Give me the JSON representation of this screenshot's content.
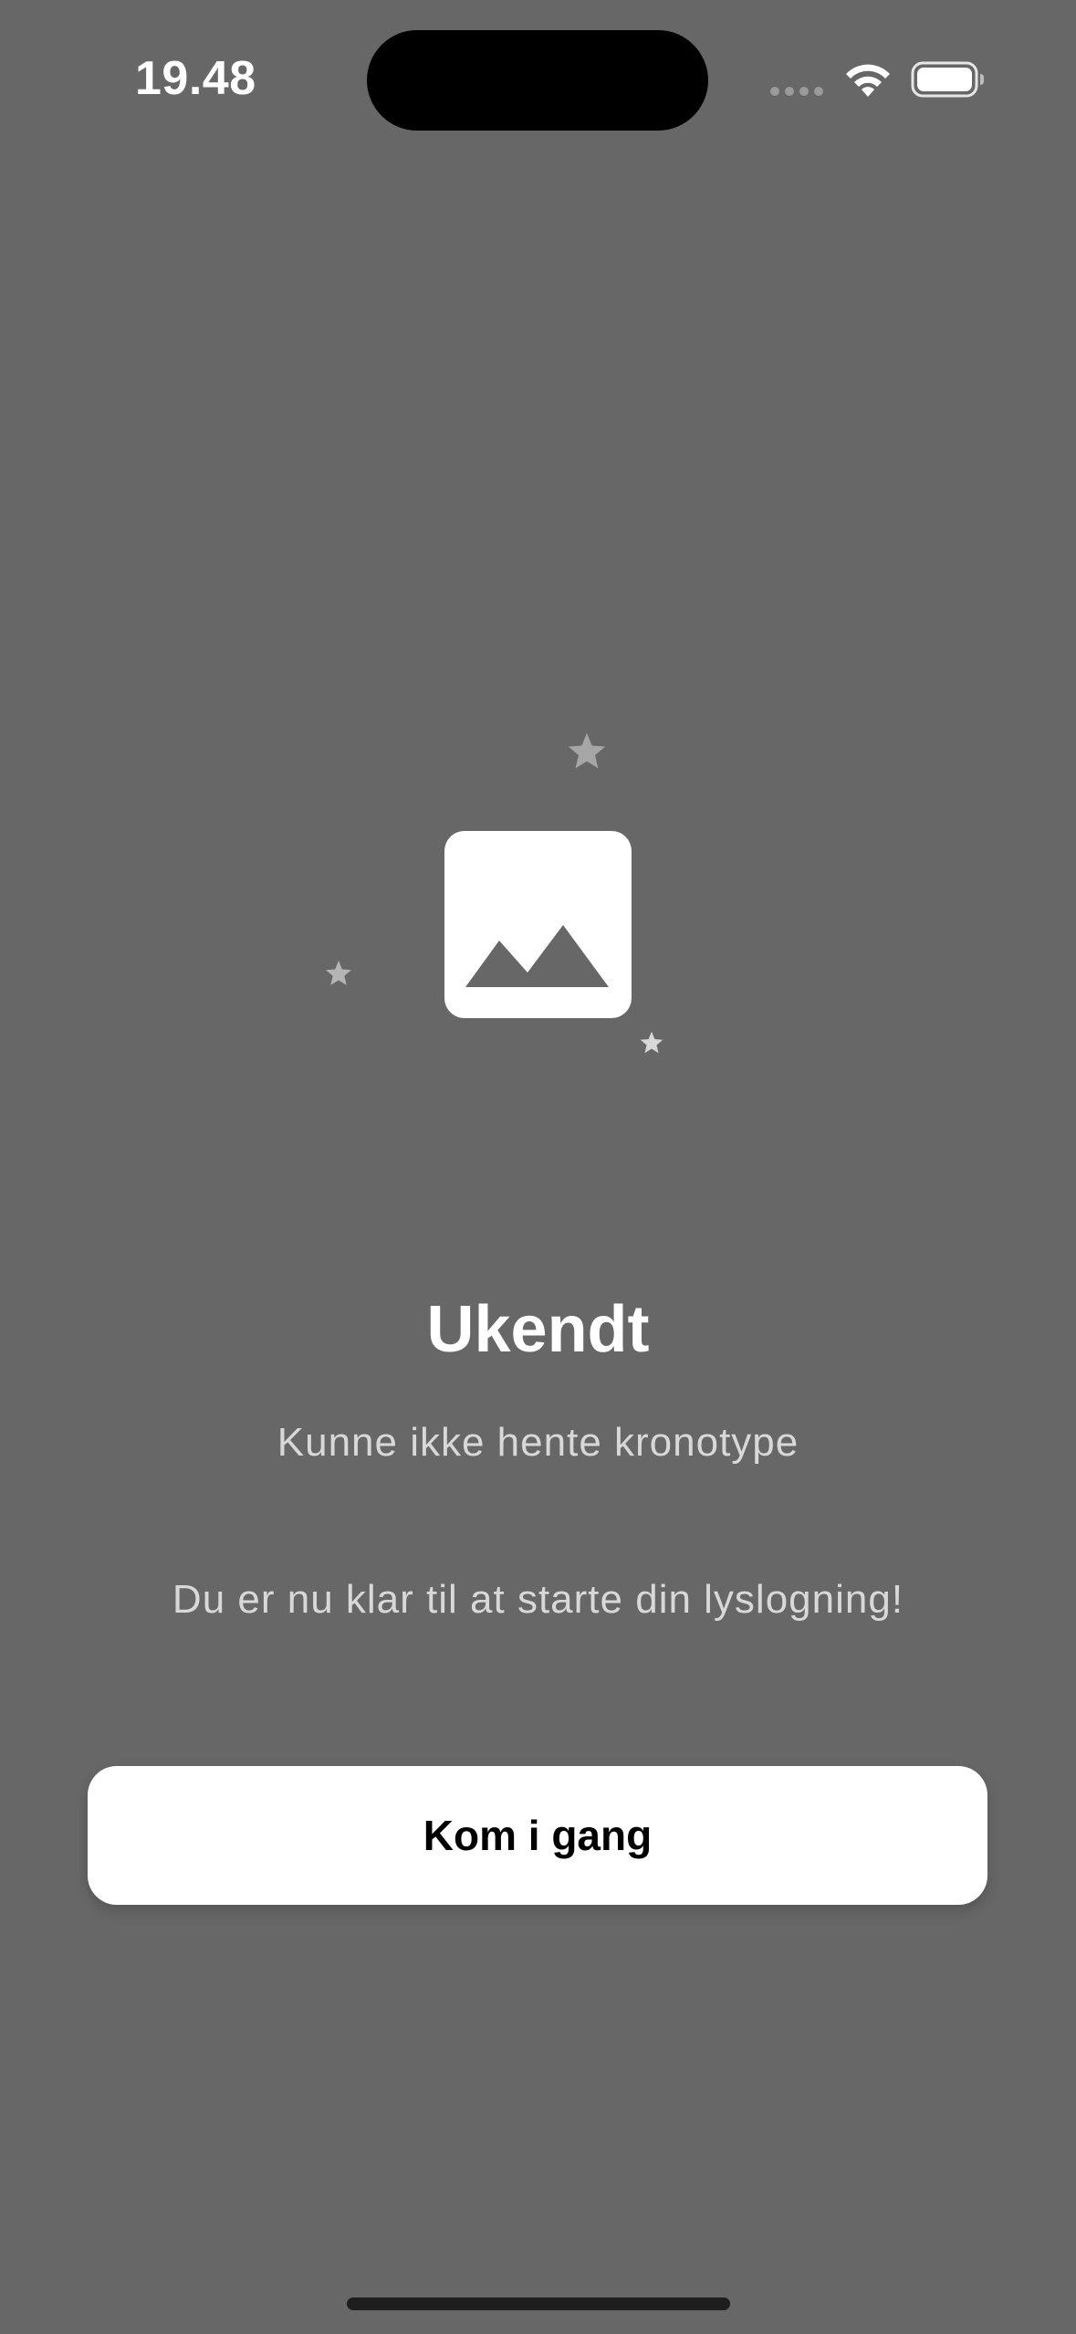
{
  "status_bar": {
    "time": "19.48",
    "icons": [
      "cellular-signal-icon",
      "wifi-icon",
      "battery-icon"
    ]
  },
  "illustration": {
    "icon": "image-placeholder-icon",
    "decorations": [
      "star-icon",
      "star-icon",
      "star-icon"
    ]
  },
  "result": {
    "title": "Ukendt",
    "subtitle": "Kunne ikke hente kronotype",
    "message": "Du er nu klar til at starte din lyslogning!"
  },
  "actions": {
    "primary_label": "Kom i gang"
  },
  "colors": {
    "background": "#676767",
    "button_background": "#ffffff",
    "button_text": "#000000",
    "secondary_text": "#d8d8d8"
  }
}
